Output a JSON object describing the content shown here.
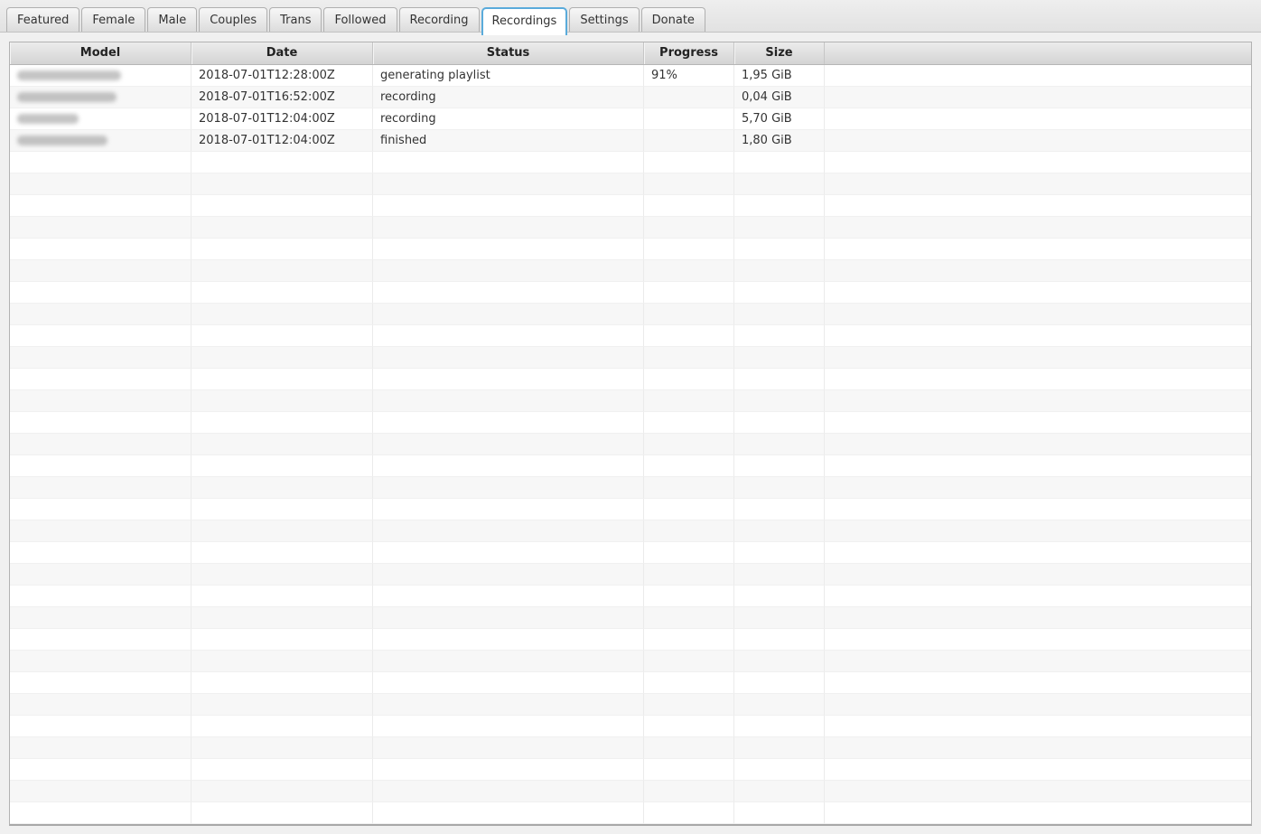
{
  "tabs": {
    "active_tab": "Recordings",
    "items": [
      {
        "label": "Featured",
        "selected": false
      },
      {
        "label": "Female",
        "selected": false
      },
      {
        "label": "Male",
        "selected": false
      },
      {
        "label": "Couples",
        "selected": false
      },
      {
        "label": "Trans",
        "selected": false
      },
      {
        "label": "Followed",
        "selected": false
      },
      {
        "label": "Recording",
        "selected": false
      },
      {
        "label": "Recordings",
        "selected": true
      },
      {
        "label": "Settings",
        "selected": false
      },
      {
        "label": "Donate",
        "selected": false
      }
    ]
  },
  "table": {
    "columns": [
      {
        "key": "model",
        "label": "Model"
      },
      {
        "key": "date",
        "label": "Date"
      },
      {
        "key": "status",
        "label": "Status"
      },
      {
        "key": "progress",
        "label": "Progress"
      },
      {
        "key": "size",
        "label": "Size"
      }
    ],
    "rows": [
      {
        "model": "[blurred]",
        "model_blur_width": 115,
        "date": "2018-07-01T12:28:00Z",
        "status": "generating playlist",
        "progress": "91%",
        "size": "1,95 GiB"
      },
      {
        "model": "[blurred]",
        "model_blur_width": 110,
        "date": "2018-07-01T16:52:00Z",
        "status": "recording",
        "progress": "",
        "size": "0,04 GiB"
      },
      {
        "model": "[blurred]",
        "model_blur_width": 68,
        "date": "2018-07-01T12:04:00Z",
        "status": "recording",
        "progress": "",
        "size": "5,70 GiB"
      },
      {
        "model": "[blurred]",
        "model_blur_width": 100,
        "date": "2018-07-01T12:04:00Z",
        "status": "finished",
        "progress": "",
        "size": "1,80 GiB"
      }
    ],
    "total_visible_rows": 35
  },
  "colors": {
    "selected_tab_border": "#5aabdb",
    "row_stripe": "#f7f7f7",
    "header_gradient_top": "#ececec",
    "header_gradient_bottom": "#d4d4d4",
    "cell_text": "#333333"
  }
}
